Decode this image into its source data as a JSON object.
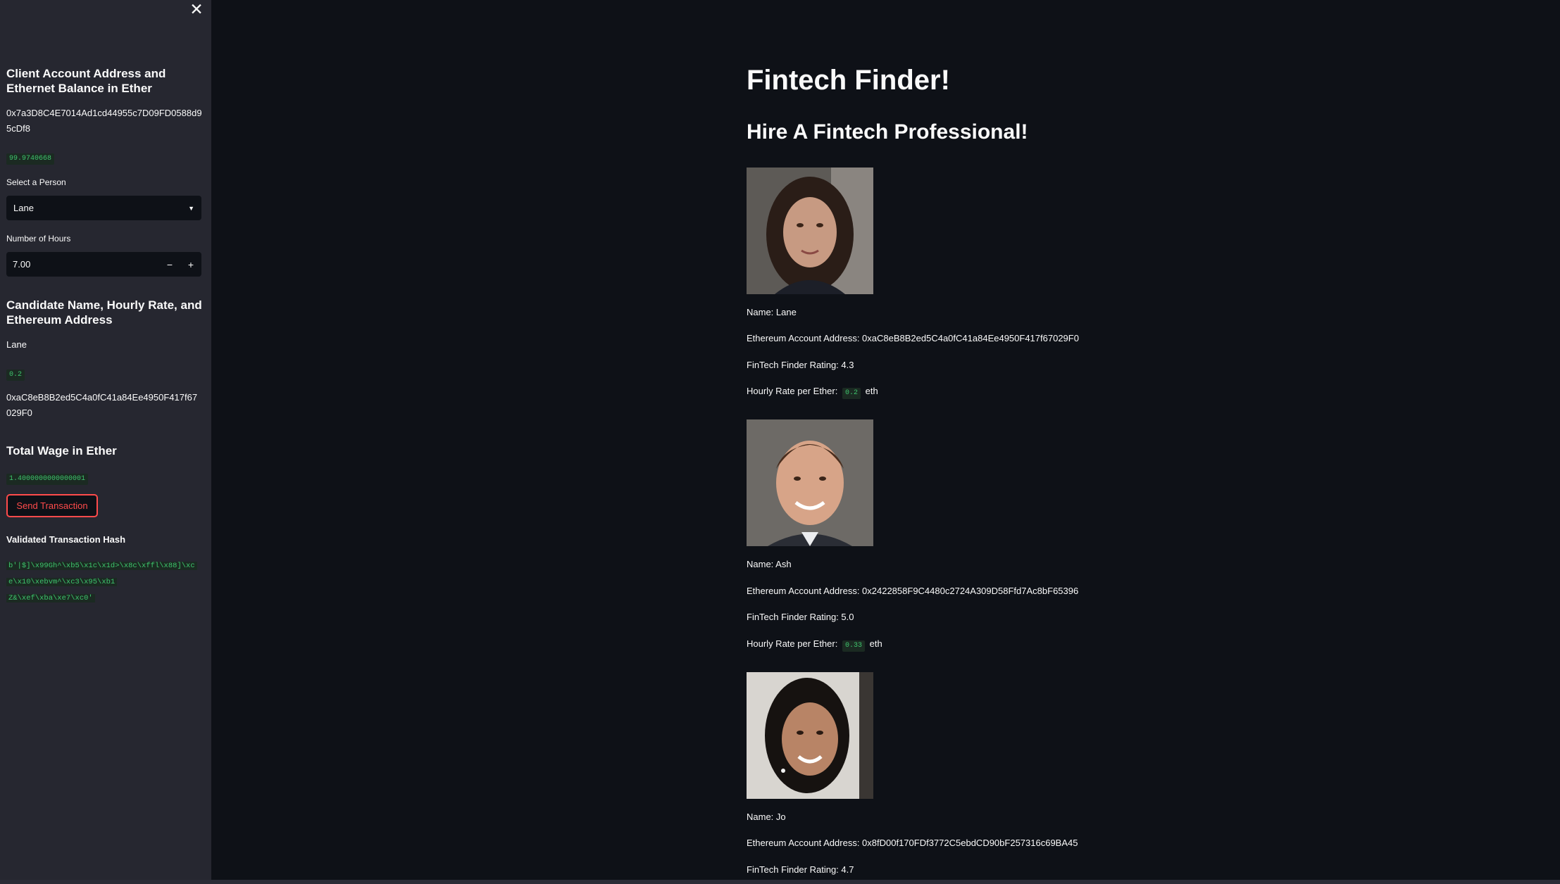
{
  "sidebar": {
    "close_label": "✕",
    "account_heading": "Client Account Address and Ethernet Balance in Ether",
    "account_address": "0x7a3D8C4E7014Ad1cd44955c7D09FD0588d95cDf8",
    "balance": "99.9740668",
    "select_label": "Select a Person",
    "select_value": "Lane",
    "hours_label": "Number of Hours",
    "hours_value": "7.00",
    "minus_label": "−",
    "plus_label": "+",
    "candidate_heading": "Candidate Name, Hourly Rate, and Ethereum Address",
    "candidate_name": "Lane",
    "candidate_rate": "0.2",
    "candidate_address": "0xaC8eB8B2ed5C4a0fC41a84Ee4950F417f67029F0",
    "wage_heading": "Total Wage in Ether",
    "wage_value": "1.4000000000000001",
    "send_button": "Send Transaction",
    "hash_heading": "Validated Transaction Hash",
    "hash_lines": [
      "b'|$]\\x99Gh^\\xb5\\x1c\\x1d>\\x8c\\xffl\\x88]\\xc",
      "e\\x10\\xebvm^\\xc3\\x95\\xb1",
      "Z&\\xef\\xba\\xe7\\xc0'"
    ]
  },
  "main": {
    "title": "Fintech Finder!",
    "subtitle": "Hire A Fintech Professional!",
    "candidates": [
      {
        "name": "Name: Lane",
        "address": "Ethereum Account Address: 0xaC8eB8B2ed5C4a0fC41a84Ee4950F417f67029F0",
        "rating": "FinTech Finder Rating: 4.3",
        "rate_prefix": "Hourly Rate per Ether:",
        "rate": "0.2",
        "rate_suffix": "eth"
      },
      {
        "name": "Name: Ash",
        "address": "Ethereum Account Address: 0x2422858F9C4480c2724A309D58Ffd7Ac8bF65396",
        "rating": "FinTech Finder Rating: 5.0",
        "rate_prefix": "Hourly Rate per Ether:",
        "rate": "0.33",
        "rate_suffix": "eth"
      },
      {
        "name": "Name: Jo",
        "address": "Ethereum Account Address: 0x8fD00f170FDf3772C5ebdCD90bF257316c69BA45",
        "rating": "FinTech Finder Rating: 4.7"
      }
    ]
  },
  "colors": {
    "background": "#0e1117",
    "sidebar": "#262730",
    "accent": "#ff4b4b",
    "code_text": "#3ec46d"
  }
}
